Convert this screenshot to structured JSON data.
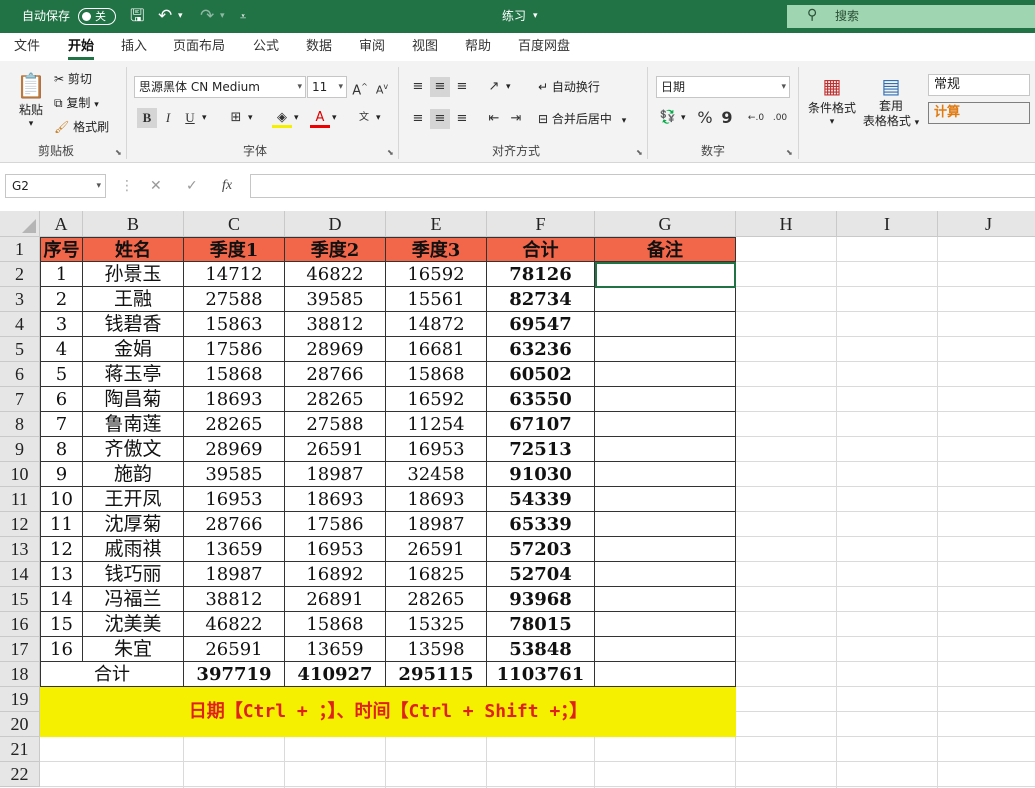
{
  "titlebar": {
    "autosave_label": "自动保存",
    "autosave_state": "关",
    "doc_title": "练习",
    "search_placeholder": "搜索",
    "accent": "#217346"
  },
  "menu": {
    "tabs": [
      "文件",
      "开始",
      "插入",
      "页面布局",
      "公式",
      "数据",
      "审阅",
      "视图",
      "帮助",
      "百度网盘"
    ],
    "active": "开始"
  },
  "ribbon": {
    "clipboard": {
      "paste": "粘贴",
      "cut": "剪切",
      "copy": "复制",
      "format_painter": "格式刷",
      "label": "剪贴板"
    },
    "font": {
      "name": "思源黑体 CN Medium",
      "size": "11",
      "bold": "B",
      "italic": "I",
      "underline": "U",
      "grow": "A",
      "shrink": "A",
      "label": "字体"
    },
    "alignment": {
      "wrap": "自动换行",
      "merge": "合并后居中",
      "label": "对齐方式"
    },
    "number": {
      "format": "日期",
      "percent": "%",
      "comma": "9",
      "label": "数字"
    },
    "styles": {
      "conditional": "条件格式",
      "table_format_1": "套用",
      "table_format_2": "表格格式",
      "style_normal": "常规",
      "style_calc": "计算"
    }
  },
  "formula_bar": {
    "name_box": "G2",
    "fx": "fx",
    "value": ""
  },
  "sheet": {
    "columns": [
      "A",
      "B",
      "C",
      "D",
      "E",
      "F",
      "G",
      "H",
      "I",
      "J"
    ],
    "row_numbers": [
      "1",
      "2",
      "3",
      "4",
      "5",
      "6",
      "7",
      "8",
      "9",
      "10",
      "11",
      "12",
      "13",
      "14",
      "15",
      "16",
      "17",
      "18",
      "19",
      "20",
      "21",
      "22"
    ],
    "headers": [
      "序号",
      "姓名",
      "季度1",
      "季度2",
      "季度3",
      "合计",
      "备注"
    ],
    "rows": [
      [
        "1",
        "孙景玉",
        "14712",
        "46822",
        "16592",
        "78126"
      ],
      [
        "2",
        "王融",
        "27588",
        "39585",
        "15561",
        "82734"
      ],
      [
        "3",
        "钱碧香",
        "15863",
        "38812",
        "14872",
        "69547"
      ],
      [
        "4",
        "金娟",
        "17586",
        "28969",
        "16681",
        "63236"
      ],
      [
        "5",
        "蒋玉亭",
        "15868",
        "28766",
        "15868",
        "60502"
      ],
      [
        "6",
        "陶昌菊",
        "18693",
        "28265",
        "16592",
        "63550"
      ],
      [
        "7",
        "鲁南莲",
        "28265",
        "27588",
        "11254",
        "67107"
      ],
      [
        "8",
        "齐傲文",
        "28969",
        "26591",
        "16953",
        "72513"
      ],
      [
        "9",
        "施韵",
        "39585",
        "18987",
        "32458",
        "91030"
      ],
      [
        "10",
        "王开凤",
        "16953",
        "18693",
        "18693",
        "54339"
      ],
      [
        "11",
        "沈厚菊",
        "28766",
        "17586",
        "18987",
        "65339"
      ],
      [
        "12",
        "戚雨祺",
        "13659",
        "16953",
        "26591",
        "57203"
      ],
      [
        "13",
        "钱巧丽",
        "18987",
        "16892",
        "16825",
        "52704"
      ],
      [
        "14",
        "冯福兰",
        "38812",
        "26891",
        "28265",
        "93968"
      ],
      [
        "15",
        "沈美美",
        "46822",
        "15868",
        "15325",
        "78015"
      ],
      [
        "16",
        "朱宜",
        "26591",
        "13659",
        "13598",
        "53848"
      ]
    ],
    "total_label": "合计",
    "totals": [
      "397719",
      "410927",
      "295115",
      "1103761"
    ],
    "note": "日期【Ctrl + ；】、时间【Ctrl + Shift +；】",
    "header_fill": "#f2674a",
    "note_fill": "#f4f000",
    "note_color": "#e0201a"
  }
}
